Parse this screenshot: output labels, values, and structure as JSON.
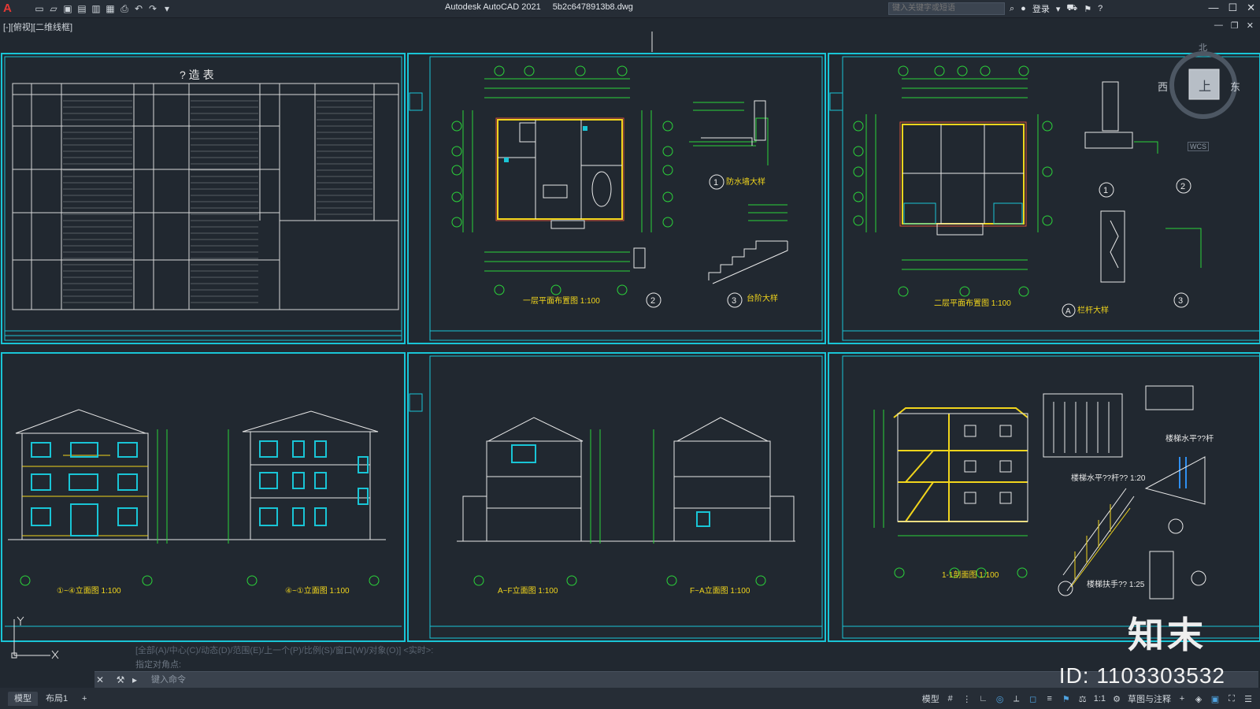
{
  "app": {
    "title": "Autodesk AutoCAD 2021",
    "file": "5b2c6478913b8.dwg",
    "logo": "A"
  },
  "toolbar": {
    "icons": [
      "new-icon",
      "open-icon",
      "save-icon",
      "saveas-icon",
      "publish-icon",
      "plot-icon",
      "print-icon",
      "undo-icon",
      "redo-icon",
      "qat-menu-icon"
    ]
  },
  "search": {
    "placeholder": "键入关键字或短语"
  },
  "account": {
    "login": "登录"
  },
  "viewport": {
    "label": "[-][俯视][二维线框]"
  },
  "viewcube": {
    "top": "上",
    "north": "北",
    "west": "西",
    "east": "东",
    "wcs": "WCS"
  },
  "sheets": [
    {
      "caption": "? 造 表"
    },
    {
      "caption": "一层平面布置图 1:100",
      "d1": "1",
      "d1label": "防水墙大样",
      "d2": "2",
      "d3": "3",
      "d3label": "台阶大样"
    },
    {
      "caption": "二层平面布置图 1:100",
      "d1": "1",
      "d2": "2",
      "d3": "3",
      "dA": "A",
      "dAlabel": "栏杆大样"
    },
    {
      "caption1": "①~④立面图 1:100",
      "caption2": "④~①立面图 1:100"
    },
    {
      "caption1": "A~F立面图 1:100",
      "caption2": "F~A立面图 1:100"
    },
    {
      "caption": "1-1剖面图 1:100",
      "t1": "楼梯水平??杆",
      "t2": "楼梯水平??杆?? 1:20",
      "t3": "楼梯扶手?? 1:25"
    }
  ],
  "command": {
    "history1": "[全部(A)/中心(C)/动态(D)/范围(E)/上一个(P)/比例(S)/窗口(W)/对象(O)] <实时>:",
    "history2": "指定对角点:",
    "placeholder": "键入命令"
  },
  "status": {
    "tabs": [
      "模型",
      "布局1"
    ],
    "model": "模型",
    "scale": "1:1",
    "workspace": "草图与注释"
  },
  "watermark": {
    "brand": "知末",
    "id": "ID: 1103303532"
  },
  "colors": {
    "frame": "#19c5d6",
    "line": "#2bd43a",
    "accent": "#f1d51c",
    "bg": "#212830"
  }
}
